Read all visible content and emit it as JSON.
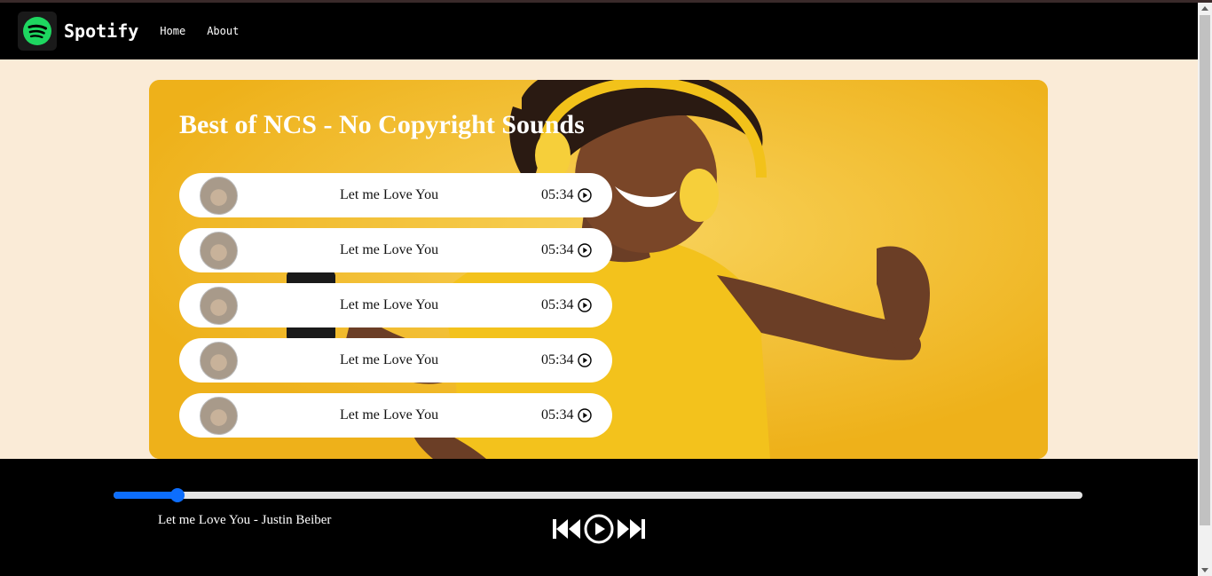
{
  "navbar": {
    "brand": "Spotify",
    "links": [
      "Home",
      "About"
    ]
  },
  "playlist": {
    "title": "Best of NCS - No Copyright Sounds",
    "songs": [
      {
        "name": "Let me Love You",
        "duration": "05:34"
      },
      {
        "name": "Let me Love You",
        "duration": "05:34"
      },
      {
        "name": "Let me Love You",
        "duration": "05:34"
      },
      {
        "name": "Let me Love You",
        "duration": "05:34"
      },
      {
        "name": "Let me Love You",
        "duration": "05:34"
      }
    ]
  },
  "player": {
    "now_playing": "Let me Love You - Justin Beiber",
    "progress_percent": 6.6
  },
  "colors": {
    "navbar_bg": "#000000",
    "page_bg": "#faebd7",
    "brand_green": "#1ed760",
    "progress_accent": "#0d6efd",
    "hero_yellow": "#f5c537"
  },
  "icons": {
    "brand": "spotify-logo-icon",
    "song_play": "play-circle-icon",
    "previous": "skip-previous-icon",
    "play": "play-circle-icon",
    "next": "skip-next-icon"
  }
}
